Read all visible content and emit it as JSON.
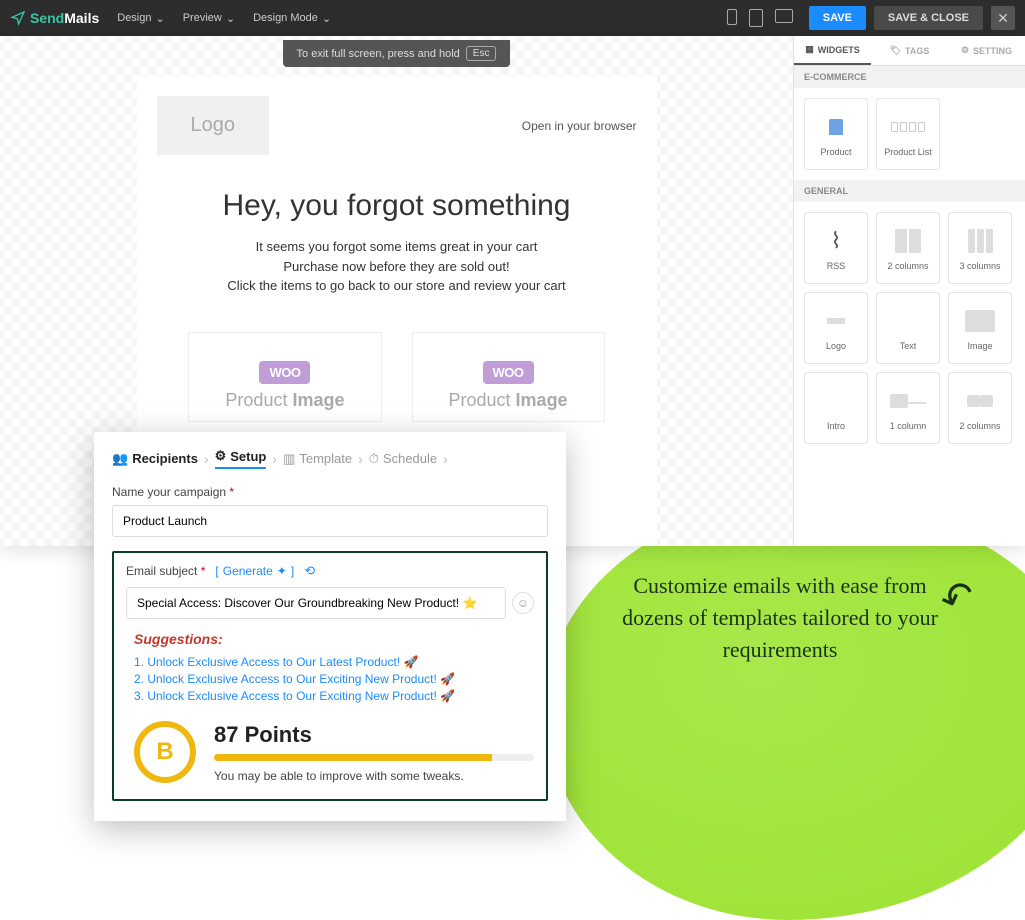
{
  "brand": {
    "left": "Send",
    "right": "Mails"
  },
  "topmenu": {
    "design": "Design",
    "preview": "Preview",
    "design_mode": "Design Mode"
  },
  "actions": {
    "save": "SAVE",
    "save_close": "SAVE & CLOSE"
  },
  "fullscreen_hint": {
    "text": "To exit full screen, press and hold",
    "key": "Esc"
  },
  "email": {
    "logo": "Logo",
    "browser_link": "Open in your browser",
    "headline": "Hey, you forgot something",
    "line1": "It seems you forgot some items great in your cart",
    "line2": "Purchase now before they are sold out!",
    "line3": "Click the items to go back to our store and review your cart",
    "woo_badge": "WOO",
    "product_label_pre": "Product ",
    "product_label_strong": "Image"
  },
  "panel": {
    "tabs": {
      "widgets": "WIDGETS",
      "tags": "TAGS",
      "setting": "SETTING"
    },
    "ecommerce_h": "E-COMMERCE",
    "general_h": "GENERAL",
    "widgets": {
      "product": "Product",
      "product_list": "Product List",
      "rss": "RSS",
      "cols2": "2 columns",
      "cols3": "3 columns",
      "logo": "Logo",
      "text": "Text",
      "image": "Image",
      "intro": "Intro",
      "col1": "1 column",
      "col2b": "2 columns"
    }
  },
  "wizard": {
    "recipients": "Recipients",
    "setup": "Setup",
    "template": "Template",
    "schedule": "Schedule"
  },
  "campaign": {
    "name_label": "Name your campaign",
    "name_value": "Product Launch",
    "subject_label": "Email subject",
    "generate": "Generate",
    "subject_value": "Special Access: Discover Our Groundbreaking New Product! ⭐",
    "suggestions_h": "Suggestions:",
    "suggestions": [
      "Unlock Exclusive Access to Our Latest Product! 🚀",
      "Unlock Exclusive Access to Our Exciting New Product! 🚀",
      "Unlock Exclusive Access to Our Exciting New Product! 🚀"
    ],
    "score_letter": "B",
    "score_points": "87 Points",
    "score_hint": "You may be able to improve with some tweaks."
  },
  "callout": "Customize emails with ease from dozens of templates tailored to your requirements"
}
